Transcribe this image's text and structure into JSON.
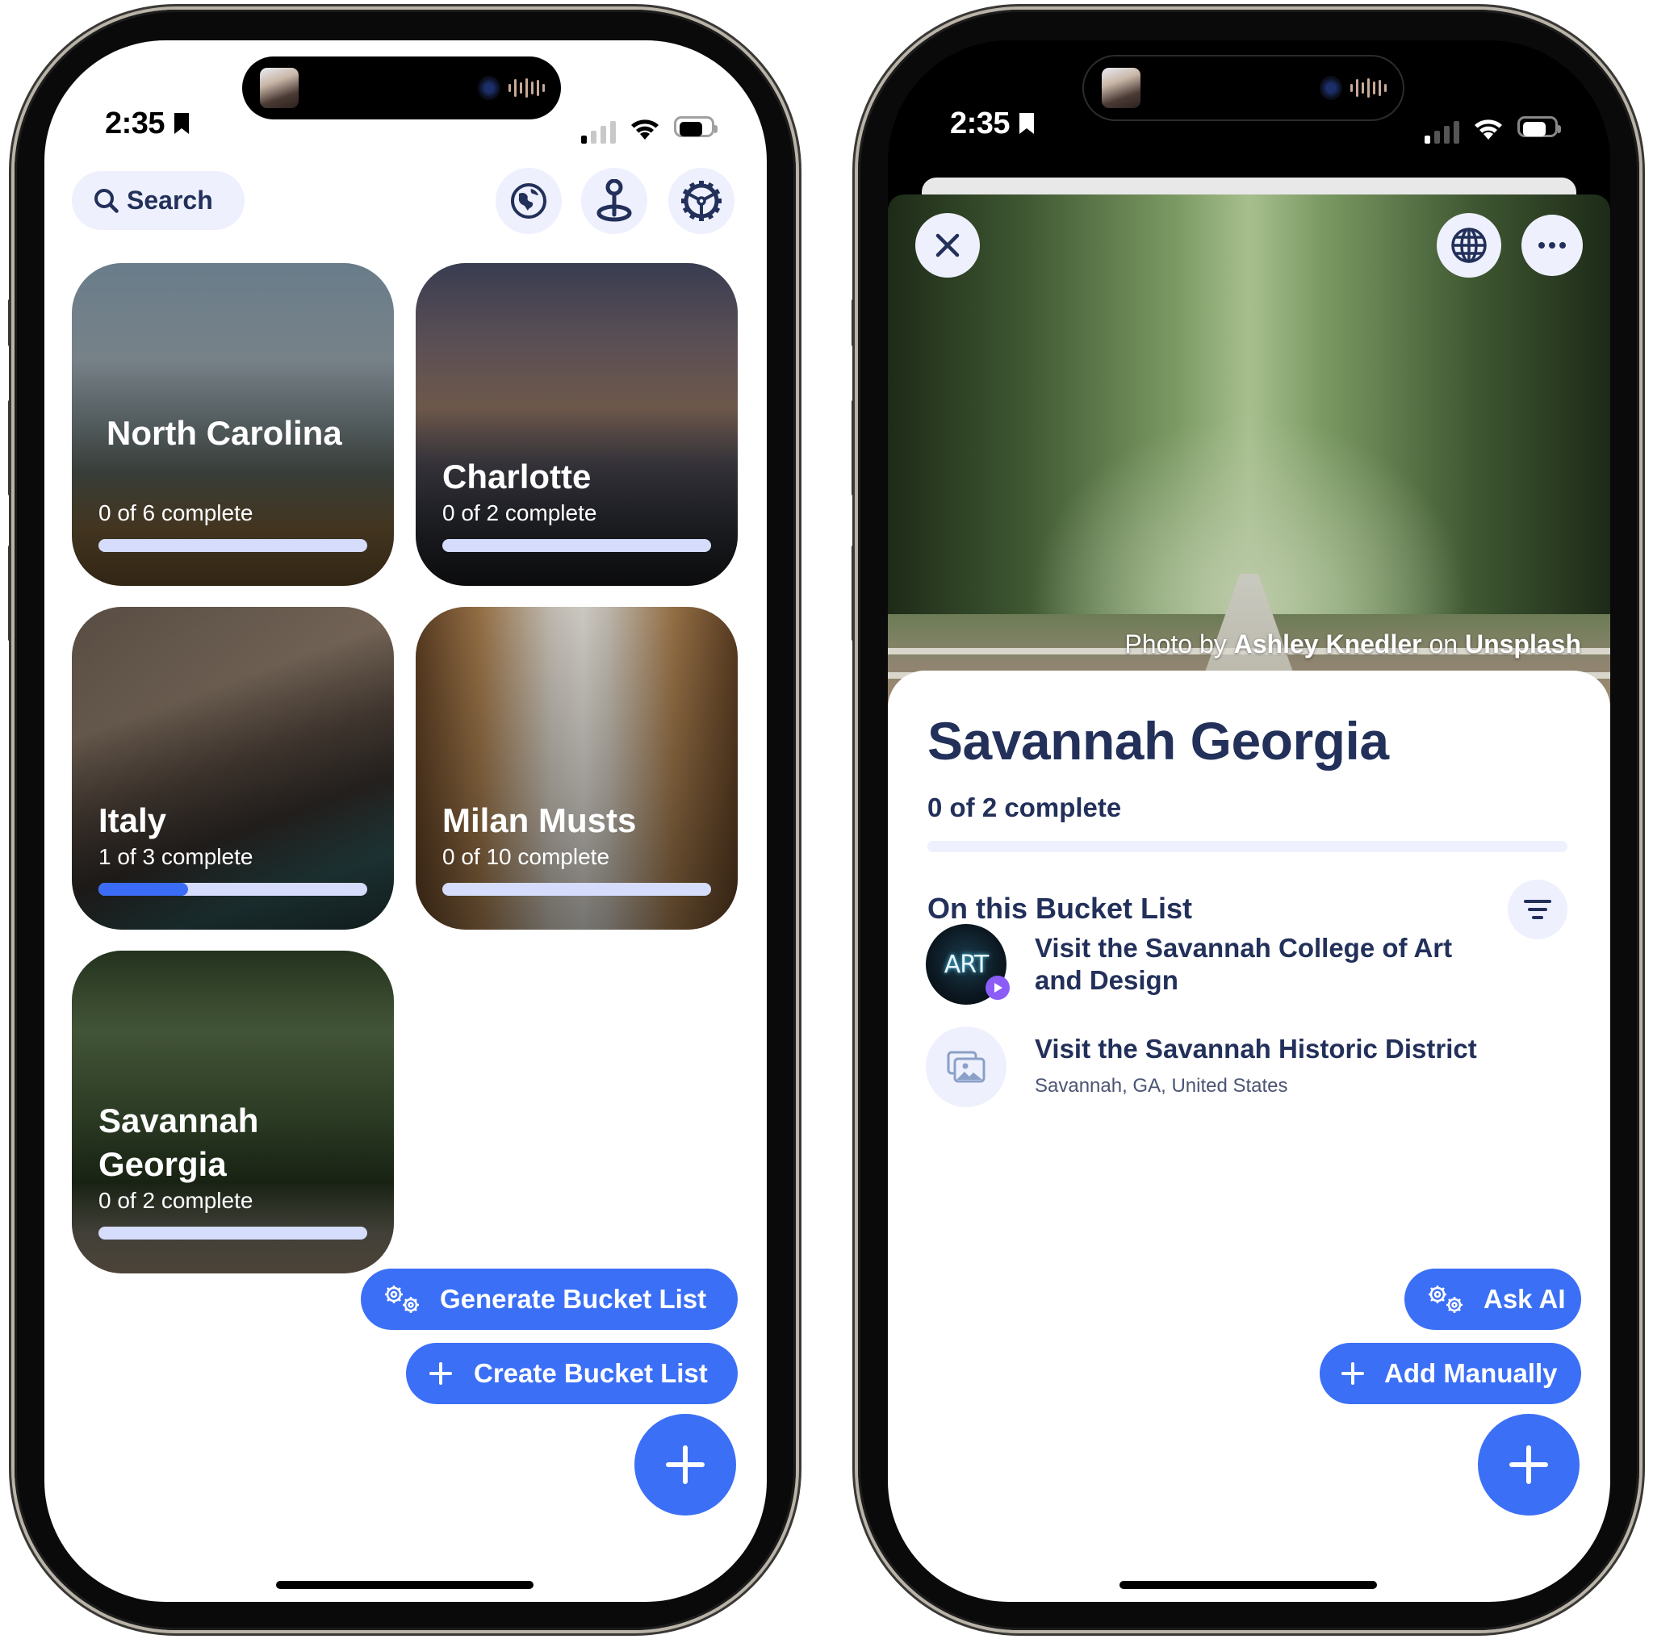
{
  "status_bar": {
    "time": "2:35"
  },
  "home_screen": {
    "search": {
      "label": "Search"
    },
    "header_icons": [
      "globe-icon",
      "map-pin-icon",
      "settings-gear-icon"
    ],
    "bucket_lists": [
      {
        "title": "North Carolina",
        "progress_text": "0 of 6 complete",
        "completed": 0,
        "total": 6,
        "theme": "mountains"
      },
      {
        "title": "Charlotte",
        "progress_text": "0 of 2 complete",
        "completed": 0,
        "total": 2,
        "theme": "city-skyline"
      },
      {
        "title": "Italy",
        "progress_text": "1 of 3 complete",
        "completed": 1,
        "total": 3,
        "theme": "trevi-fountain"
      },
      {
        "title": "Milan Musts",
        "progress_text": "0 of 10 complete",
        "completed": 0,
        "total": 10,
        "theme": "galleria"
      },
      {
        "title": "Savannah Georgia",
        "progress_text": "0 of 2 complete",
        "completed": 0,
        "total": 2,
        "theme": "oak-avenue"
      }
    ],
    "actions": {
      "generate_label": "Generate Bucket List",
      "create_label": "Create Bucket List"
    }
  },
  "detail_screen": {
    "photo_credit": {
      "prefix": "Photo by",
      "author": "Ashley Knedler",
      "middle": "on",
      "source": "Unsplash"
    },
    "title": "Savannah Georgia",
    "progress_text": "0 of 2 complete",
    "progress": {
      "completed": 0,
      "total": 2
    },
    "section_heading": "On this Bucket List",
    "items": [
      {
        "title": "Visit the Savannah College of Art and Design",
        "subtitle": "",
        "thumb": "art-neon-sign"
      },
      {
        "title": "Visit the Savannah Historic District",
        "subtitle": "Savannah, GA, United States",
        "thumb": "image-placeholder"
      }
    ],
    "actions": {
      "ask_ai_label": "Ask AI",
      "add_manually_label": "Add Manually"
    }
  },
  "colors": {
    "accent": "#3b6ff6",
    "navy_text": "#22305a",
    "pill_bg": "#eef0fd",
    "progress_track": "#d6dcfb"
  }
}
